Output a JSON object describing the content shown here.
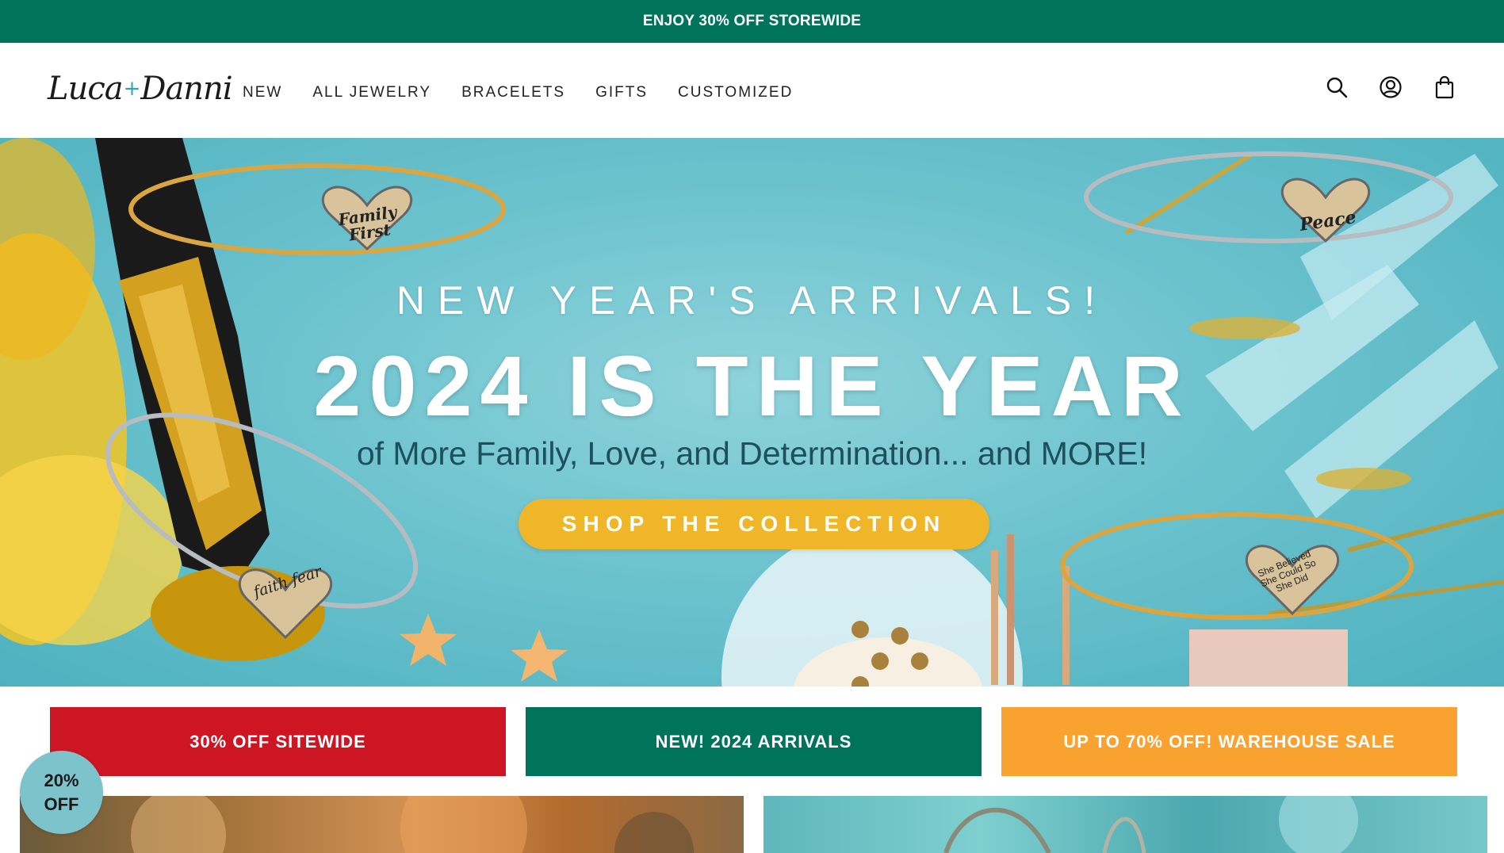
{
  "announcement": {
    "text": "ENJOY 30% OFF STOREWIDE"
  },
  "header": {
    "logo_left": "Luca",
    "logo_plus": "+",
    "logo_right": "Danni",
    "nav": [
      "NEW",
      "ALL JEWELRY",
      "BRACELETS",
      "GIFTS",
      "CUSTOMIZED"
    ],
    "icons": [
      "search-icon",
      "account-icon",
      "cart-icon"
    ]
  },
  "hero": {
    "subtitle": "NEW YEAR'S ARRIVALS!",
    "title": "2024 IS THE YEAR",
    "line": "of More Family, Love, and Determination... and MORE!",
    "cta": "SHOP THE COLLECTION",
    "charms": [
      "Family First",
      "Peace",
      "faith fear",
      "She Believed She Could So She Did"
    ]
  },
  "promos": [
    {
      "label": "30% OFF SITEWIDE",
      "color": "#cd1524"
    },
    {
      "label": "NEW! 2024 ARRIVALS",
      "color": "#00745b"
    },
    {
      "label": "UP TO 70% OFF! WAREHOUSE SALE",
      "color": "#f9a22f"
    }
  ],
  "badge": {
    "line1": "20%",
    "line2": "OFF"
  },
  "colors": {
    "brand_green": "#00745b",
    "cta_yellow": "#f0b629",
    "hero_teal": "#6cc3ce"
  }
}
